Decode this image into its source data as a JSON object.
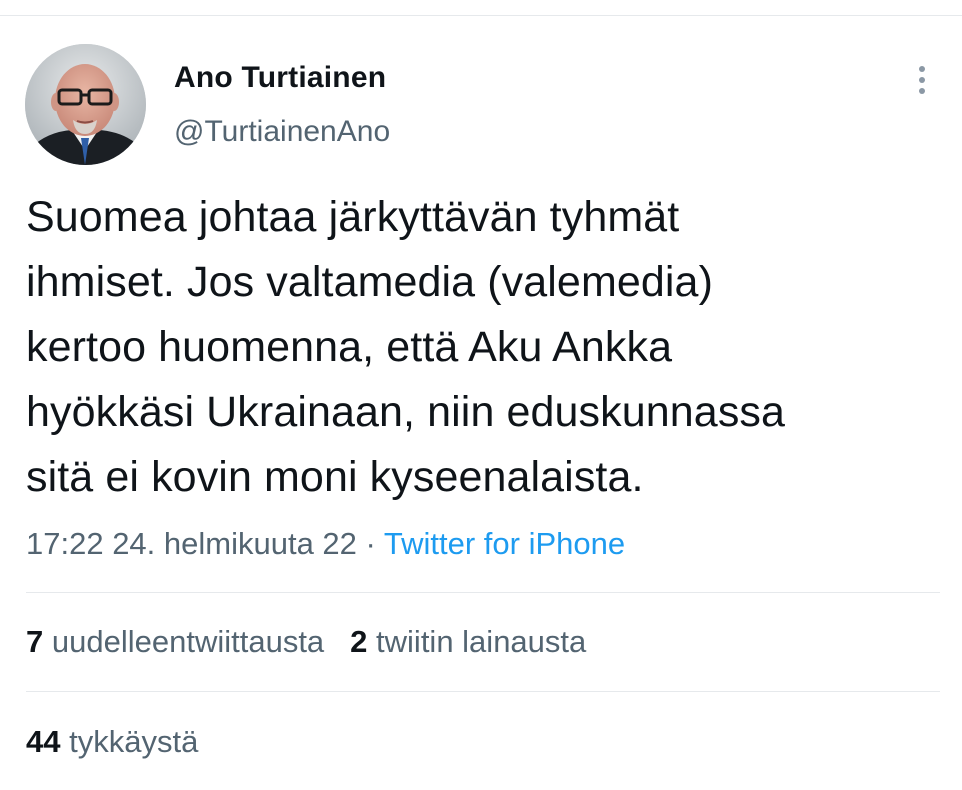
{
  "tweet": {
    "author": {
      "name": "Ano Turtiainen",
      "handle": "@TurtiainenAno",
      "avatar_icon": "profile-photo"
    },
    "more_icon": "more-vertical-icon",
    "text": "Suomea johtaa järkyttävän tyhmät\nihmiset. Jos valtamedia (valemedia)\nkertoo huomenna, että Aku Ankka\nhyökkäsi Ukrainaan, niin eduskunnassa\nsitä ei kovin moni kyseenalaista.",
    "timestamp": "17:22 24. helmikuuta 22",
    "separator": " · ",
    "source": "Twitter for iPhone",
    "stats": {
      "retweets_count": "7",
      "retweets_label": "uudelleentwiittausta",
      "quotes_count": "2",
      "quotes_label": "twiitin lainausta",
      "likes_count": "44",
      "likes_label": "tykkäystä"
    }
  },
  "colors": {
    "text_primary": "#0f1419",
    "text_secondary": "#536471",
    "link": "#1d9bf0",
    "divider": "#e6e9ec"
  }
}
